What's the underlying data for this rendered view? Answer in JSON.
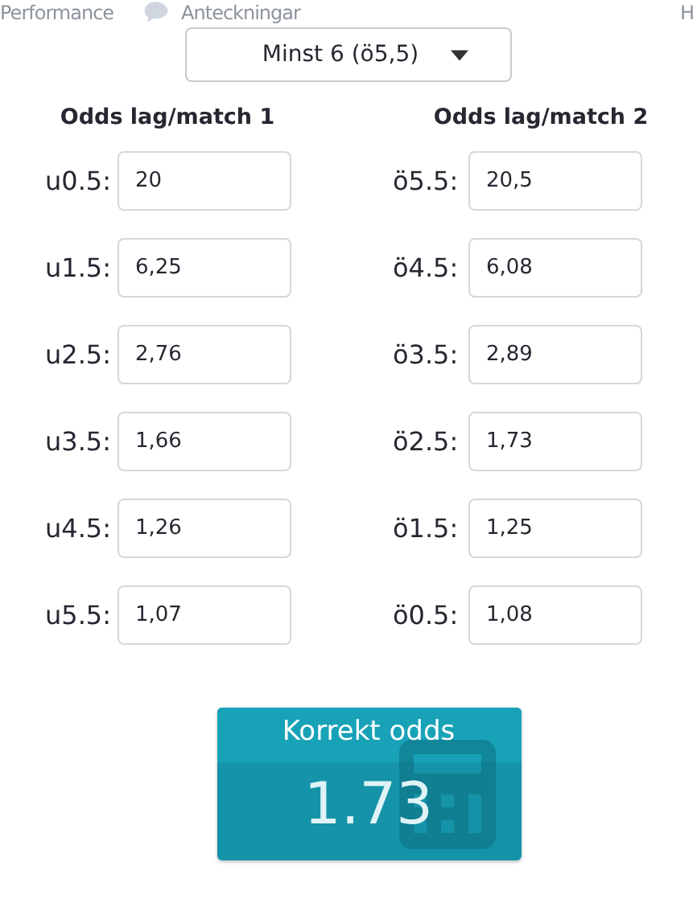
{
  "nav": [
    {
      "label": "Performance",
      "icon": false
    },
    {
      "label": "Anteckningar",
      "icon": true
    },
    {
      "label": "H",
      "icon": false
    }
  ],
  "dropdown": {
    "value": "Minst 6 (ö5,5)"
  },
  "columns": [
    {
      "heading": "Odds lag/match 1",
      "rows": [
        {
          "label": "u0.5:",
          "value": "20"
        },
        {
          "label": "u1.5:",
          "value": "6,25"
        },
        {
          "label": "u2.5:",
          "value": "2,76"
        },
        {
          "label": "u3.5:",
          "value": "1,66"
        },
        {
          "label": "u4.5:",
          "value": "1,26"
        },
        {
          "label": "u5.5:",
          "value": "1,07"
        }
      ]
    },
    {
      "heading": "Odds lag/match 2",
      "rows": [
        {
          "label": "ö5.5:",
          "value": "20,5"
        },
        {
          "label": "ö4.5:",
          "value": "6,08"
        },
        {
          "label": "ö3.5:",
          "value": "2,89"
        },
        {
          "label": "ö2.5:",
          "value": "1,73"
        },
        {
          "label": "ö1.5:",
          "value": "1,25"
        },
        {
          "label": "ö0.5:",
          "value": "1,08"
        }
      ]
    }
  ],
  "result": {
    "title": "Korrekt odds",
    "value": "1.73"
  }
}
